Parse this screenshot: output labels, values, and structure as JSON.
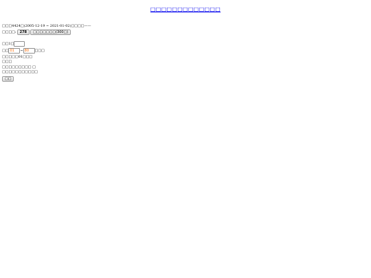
{
  "header": {
    "title": "□□□□□□□□□□□□□"
  },
  "info": {
    "text": "□□□4424□(2005-12-19 ~ 2021-01-02)□□□□——"
  },
  "period": {
    "label": "□□□□:",
    "current_button": "278",
    "option_button": "□□□□□□□(300□)"
  },
  "count": {
    "label": "□□1□",
    "value": ""
  },
  "range": {
    "label": "□□",
    "from_placeholder": "01",
    "separator": "~",
    "to_placeholder": "80",
    "suffix": "□□□"
  },
  "notes": {
    "line1": "□□□□□01□□□",
    "line2": "□□□",
    "line3": "□□□□□□□□□ □",
    "line4": "□□□□□□□□□□□"
  },
  "actions": {
    "submit_label": "□□"
  }
}
